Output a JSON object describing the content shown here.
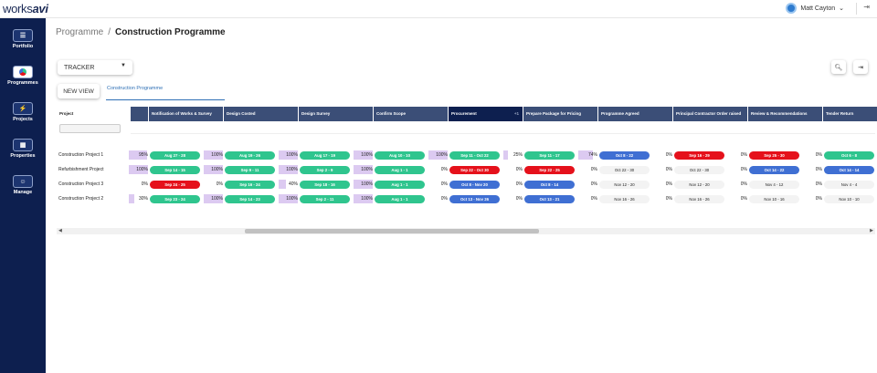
{
  "header": {
    "logo_plain": "works",
    "logo_bold": "avi",
    "user_name": "Matt Cayton",
    "user_caret": "⌄",
    "logout_icon": "logout-icon"
  },
  "sidebar": {
    "items": [
      {
        "label": "Portfolio",
        "icon": "list-icon"
      },
      {
        "label": "Programmes",
        "icon": "programme-icon"
      },
      {
        "label": "Projects",
        "icon": "bolt-icon"
      },
      {
        "label": "Properties",
        "icon": "building-icon"
      },
      {
        "label": "Manage",
        "icon": "person-icon"
      }
    ]
  },
  "breadcrumb": {
    "parent": "Programme",
    "separator": "/",
    "current": "Construction Programme"
  },
  "toolbar": {
    "view_select": "TRACKER",
    "new_view": "NEW VIEW",
    "tab": "Construction Programme"
  },
  "grid": {
    "project_header": "Project",
    "stages": [
      {
        "name": "Notification of Works & Survey",
        "count": ""
      },
      {
        "name": "Design Costed",
        "count": ""
      },
      {
        "name": "Design Survey",
        "count": ""
      },
      {
        "name": "Confirm Scope",
        "count": ""
      },
      {
        "name": "Procurement",
        "count": "+1",
        "highlight": true
      },
      {
        "name": "Prepare Package for Pricing",
        "count": ""
      },
      {
        "name": "Programme Agreed",
        "count": ""
      },
      {
        "name": "Principal Contractor Order raised",
        "count": ""
      },
      {
        "name": "Review & Recommendations",
        "count": ""
      },
      {
        "name": "Tender Return",
        "count": ""
      }
    ],
    "rows": [
      {
        "project": "Construction Project 1",
        "cells": [
          {
            "pct": "95%",
            "fill": 0.95,
            "dates": "Aug 27  -  28",
            "status": "green"
          },
          {
            "pct": "100%",
            "fill": 1.0,
            "dates": "Aug 19  -  26",
            "status": "green"
          },
          {
            "pct": "100%",
            "fill": 1.0,
            "dates": "Aug 17  -  19",
            "status": "green"
          },
          {
            "pct": "100%",
            "fill": 1.0,
            "dates": "Aug 10  -  10",
            "status": "green"
          },
          {
            "pct": "100%",
            "fill": 1.0,
            "dates": "Sep 11  -  Oct 22",
            "status": "green"
          },
          {
            "pct": "25%",
            "fill": 0.25,
            "dates": "Sep 11  -  17",
            "status": "green"
          },
          {
            "pct": "74%",
            "fill": 0.74,
            "dates": "Oct 8  -  22",
            "status": "blue"
          },
          {
            "pct": "0%",
            "fill": 0,
            "dates": "Sep 16  -  29",
            "status": "red"
          },
          {
            "pct": "0%",
            "fill": 0,
            "dates": "Sep 25  -  30",
            "status": "red"
          },
          {
            "pct": "0%",
            "fill": 0,
            "dates": "Oct 6  -  8",
            "status": "green"
          }
        ]
      },
      {
        "project": "Refurbishment Project",
        "cells": [
          {
            "pct": "100%",
            "fill": 1.0,
            "dates": "Sep 14  -  15",
            "status": "green"
          },
          {
            "pct": "100%",
            "fill": 1.0,
            "dates": "Sep 9  -  11",
            "status": "green"
          },
          {
            "pct": "100%",
            "fill": 1.0,
            "dates": "Sep 2  -  9",
            "status": "green"
          },
          {
            "pct": "100%",
            "fill": 1.0,
            "dates": "Aug 1  -  1",
            "status": "green"
          },
          {
            "pct": "0%",
            "fill": 0,
            "dates": "Sep 22  -  Oct 30",
            "status": "red"
          },
          {
            "pct": "0%",
            "fill": 0,
            "dates": "Sep 22  -  25",
            "status": "red"
          },
          {
            "pct": "0%",
            "fill": 0,
            "dates": "Oct 22  -  30",
            "status": "none"
          },
          {
            "pct": "0%",
            "fill": 0,
            "dates": "Oct 22  -  30",
            "status": "none"
          },
          {
            "pct": "0%",
            "fill": 0,
            "dates": "Oct 14  -  22",
            "status": "blue"
          },
          {
            "pct": "0%",
            "fill": 0,
            "dates": "Oct 14  -  14",
            "status": "blue"
          }
        ]
      },
      {
        "project": "Construction Project 3",
        "cells": [
          {
            "pct": "0%",
            "fill": 0,
            "dates": "Sep 24  -  25",
            "status": "red"
          },
          {
            "pct": "0%",
            "fill": 0,
            "dates": "Sep 16  -  24",
            "status": "green"
          },
          {
            "pct": "40%",
            "fill": 0.4,
            "dates": "Sep 18  -  16",
            "status": "green"
          },
          {
            "pct": "100%",
            "fill": 1.0,
            "dates": "Aug 1  -  1",
            "status": "green"
          },
          {
            "pct": "0%",
            "fill": 0,
            "dates": "Oct 8  -  Nov 20",
            "status": "blue"
          },
          {
            "pct": "0%",
            "fill": 0,
            "dates": "Oct 8  -  14",
            "status": "blue"
          },
          {
            "pct": "0%",
            "fill": 0,
            "dates": "Nov 12  -  20",
            "status": "none"
          },
          {
            "pct": "0%",
            "fill": 0,
            "dates": "Nov 12  -  20",
            "status": "none"
          },
          {
            "pct": "0%",
            "fill": 0,
            "dates": "Nov 4  -  12",
            "status": "none"
          },
          {
            "pct": "0%",
            "fill": 0,
            "dates": "Nov 4  -  4",
            "status": "none"
          }
        ]
      },
      {
        "project": "Construction Project 2",
        "cells": [
          {
            "pct": "30%",
            "fill": 0.3,
            "dates": "Sep 23  -  24",
            "status": "green"
          },
          {
            "pct": "100%",
            "fill": 1.0,
            "dates": "Sep 14  -  23",
            "status": "green"
          },
          {
            "pct": "100%",
            "fill": 1.0,
            "dates": "Sep 2  -  11",
            "status": "green"
          },
          {
            "pct": "100%",
            "fill": 1.0,
            "dates": "Aug 1  -  1",
            "status": "green"
          },
          {
            "pct": "0%",
            "fill": 0,
            "dates": "Oct 13  -  Nov 26",
            "status": "blue"
          },
          {
            "pct": "0%",
            "fill": 0,
            "dates": "Oct 13  -  21",
            "status": "blue"
          },
          {
            "pct": "0%",
            "fill": 0,
            "dates": "Nov 16  -  26",
            "status": "none"
          },
          {
            "pct": "0%",
            "fill": 0,
            "dates": "Nov 16  -  26",
            "status": "none"
          },
          {
            "pct": "0%",
            "fill": 0,
            "dates": "Nov 10  -  16",
            "status": "none"
          },
          {
            "pct": "0%",
            "fill": 0,
            "dates": "Nov 10  -  10",
            "status": "none"
          }
        ]
      }
    ]
  },
  "colors": {
    "sidebar": "#0d1f4f",
    "header_cell": "#3b4e77",
    "green": "#2fc58e",
    "red": "#e5111b",
    "blue": "#3f6fd3",
    "progress": "#dccaf1",
    "accent": "#2d6fb5"
  }
}
